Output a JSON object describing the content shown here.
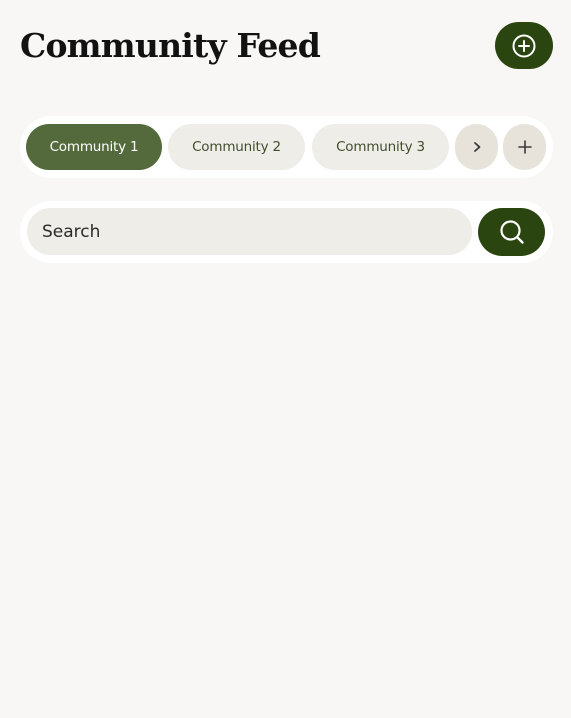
{
  "header": {
    "title": "Community Feed",
    "new_post_icon": "plus-circle-icon"
  },
  "community_tabs": {
    "items": [
      {
        "label": "Community 1",
        "active": true
      },
      {
        "label": "Community 2",
        "active": false
      },
      {
        "label": "Community 3",
        "active": false
      }
    ],
    "next_icon": "chevron-right-icon",
    "add_icon": "plus-icon"
  },
  "search": {
    "placeholder": "Search",
    "value": "",
    "button_icon": "search-icon"
  },
  "colors": {
    "background": "#f8f7f5",
    "primary_dark_green": "#2b4511",
    "active_tab_green": "#546a3c",
    "chip_background": "#efede7",
    "round_button_background": "#e7e3db",
    "title_text": "#121212"
  }
}
